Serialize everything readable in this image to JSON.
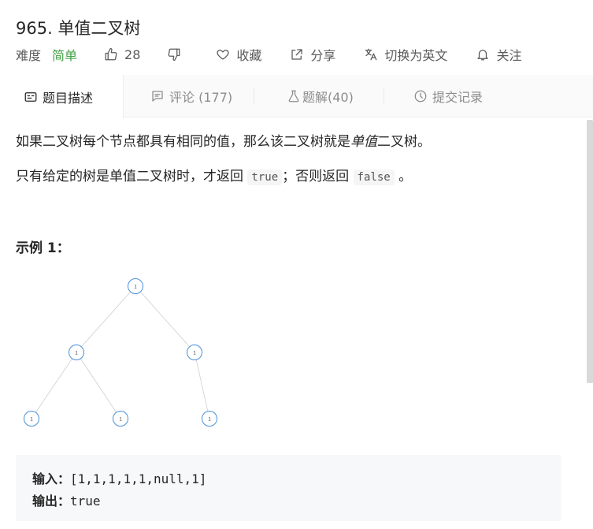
{
  "problem": {
    "title": "965. 单值二叉树",
    "difficulty_label": "难度",
    "difficulty": "简单",
    "likes": "28",
    "favorite_label": "收藏",
    "share_label": "分享",
    "lang_label": "切换为英文",
    "follow_label": "关注"
  },
  "tabs": [
    {
      "label": "题目描述",
      "icon": "description-icon"
    },
    {
      "label": "评论 (177)",
      "icon": "comment-icon"
    },
    {
      "label": "题解(40)",
      "icon": "flask-icon"
    },
    {
      "label": "提交记录",
      "icon": "clock-icon"
    }
  ],
  "description": {
    "p1_before": "如果二叉树每个节点都具有相同的值，那么该二叉树就是",
    "p1_em": "单值",
    "p1_after": "二叉树。",
    "p2_before": "只有给定的树是单值二叉树时，才返回",
    "p2_code1": "true",
    "p2_mid": "；否则返回",
    "p2_code2": "false",
    "p2_after": "。"
  },
  "example": {
    "title": "示例 1：",
    "tree_values": [
      "1",
      "1",
      "1",
      "1",
      "1",
      "1"
    ],
    "input_label": "输入：",
    "input_value": "[1,1,1,1,1,null,1]",
    "output_label": "输出：",
    "output_value": "true"
  },
  "colors": {
    "accent_green": "#43a047",
    "tree_node_stroke": "#4a90d9"
  }
}
